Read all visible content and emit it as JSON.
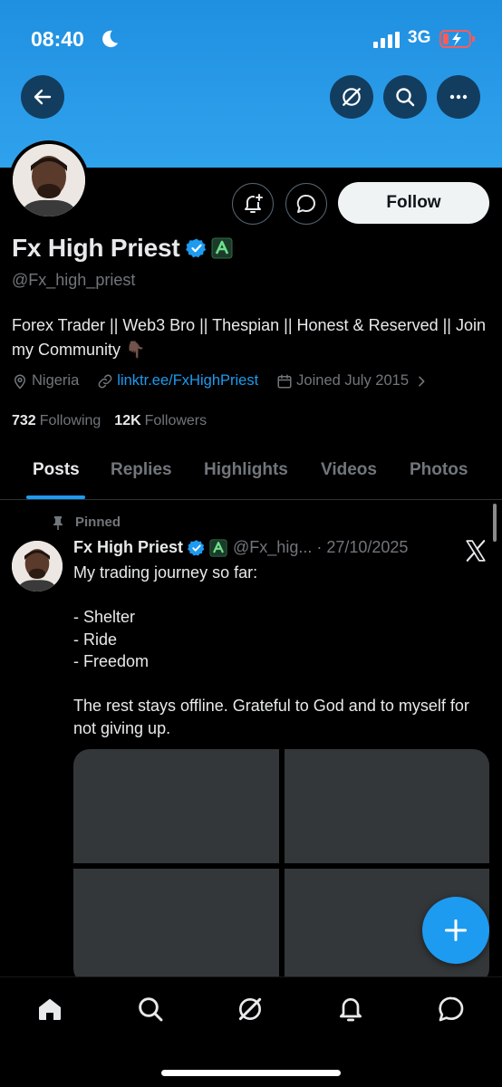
{
  "status_bar": {
    "time": "08:40",
    "network": "3G"
  },
  "header": {
    "back_icon": "arrow-left-icon",
    "grok_icon": "grok-icon",
    "search_icon": "search-icon",
    "more_icon": "more-horizontal-icon"
  },
  "profile": {
    "name": "Fx High Priest",
    "handle": "@Fx_high_priest",
    "bio": "Forex Trader || Web3 Bro || Thespian || Honest & Reserved || Join my Community 👇🏿",
    "location": "Nigeria",
    "link": "linktr.ee/FxHighPriest",
    "joined": "Joined July 2015",
    "following_count": "732",
    "following_label": "Following",
    "followers_count": "12K",
    "followers_label": "Followers",
    "follow_label": "Follow"
  },
  "tabs": [
    {
      "label": "Posts",
      "active": true
    },
    {
      "label": "Replies",
      "active": false
    },
    {
      "label": "Highlights",
      "active": false
    },
    {
      "label": "Videos",
      "active": false
    },
    {
      "label": "Photos",
      "active": false
    }
  ],
  "pinned_post": {
    "pinned_label": "Pinned",
    "author": "Fx High Priest",
    "handle_date": "@Fx_hig... · 27/10/2025",
    "text": "My trading journey so far:\n\n- Shelter\n- Ride\n- Freedom\n\nThe rest stays offline. Grateful to God and to myself for not giving up."
  },
  "bottom_nav": [
    "home-icon",
    "search-icon",
    "grok-icon",
    "notifications-icon",
    "messages-icon"
  ],
  "colors": {
    "accent": "#1d9bf0",
    "background": "#000000",
    "muted": "#71767b",
    "banner": "#2a9be8"
  }
}
